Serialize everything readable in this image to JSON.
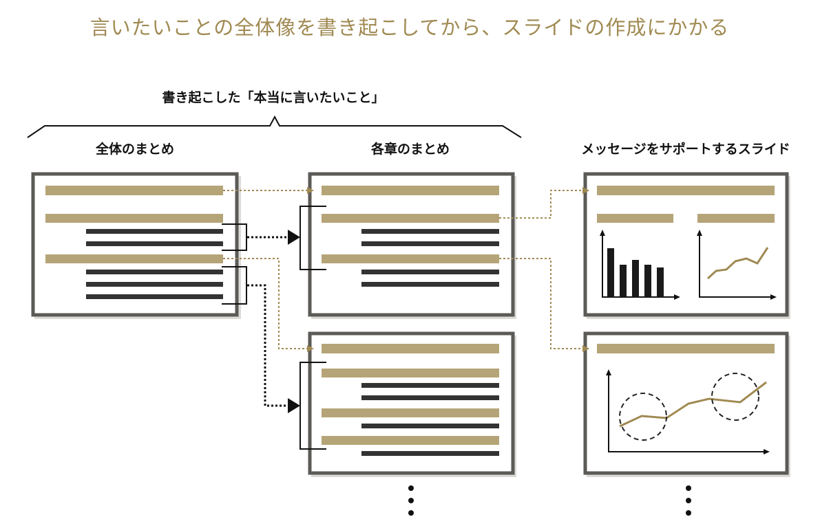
{
  "title": "言いたいことの全体像を書き起こしてから、スライドの作成にかかる",
  "brace_label": "書き起こした「本当に言いたいこと」",
  "columns": {
    "overall": "全体のまとめ",
    "chapters": "各章のまとめ",
    "slides": "メッセージをサポートするスライド"
  },
  "colors": {
    "accent_gold": "#b5a477",
    "arrow_gold": "#a08a52",
    "dark_bar": "#333333",
    "frame": "#5c5a57"
  },
  "icons": [
    "triangle-arrow-icon",
    "ellipsis-icon",
    "bar-chart-icon",
    "line-chart-icon",
    "dashed-circle-icon"
  ]
}
